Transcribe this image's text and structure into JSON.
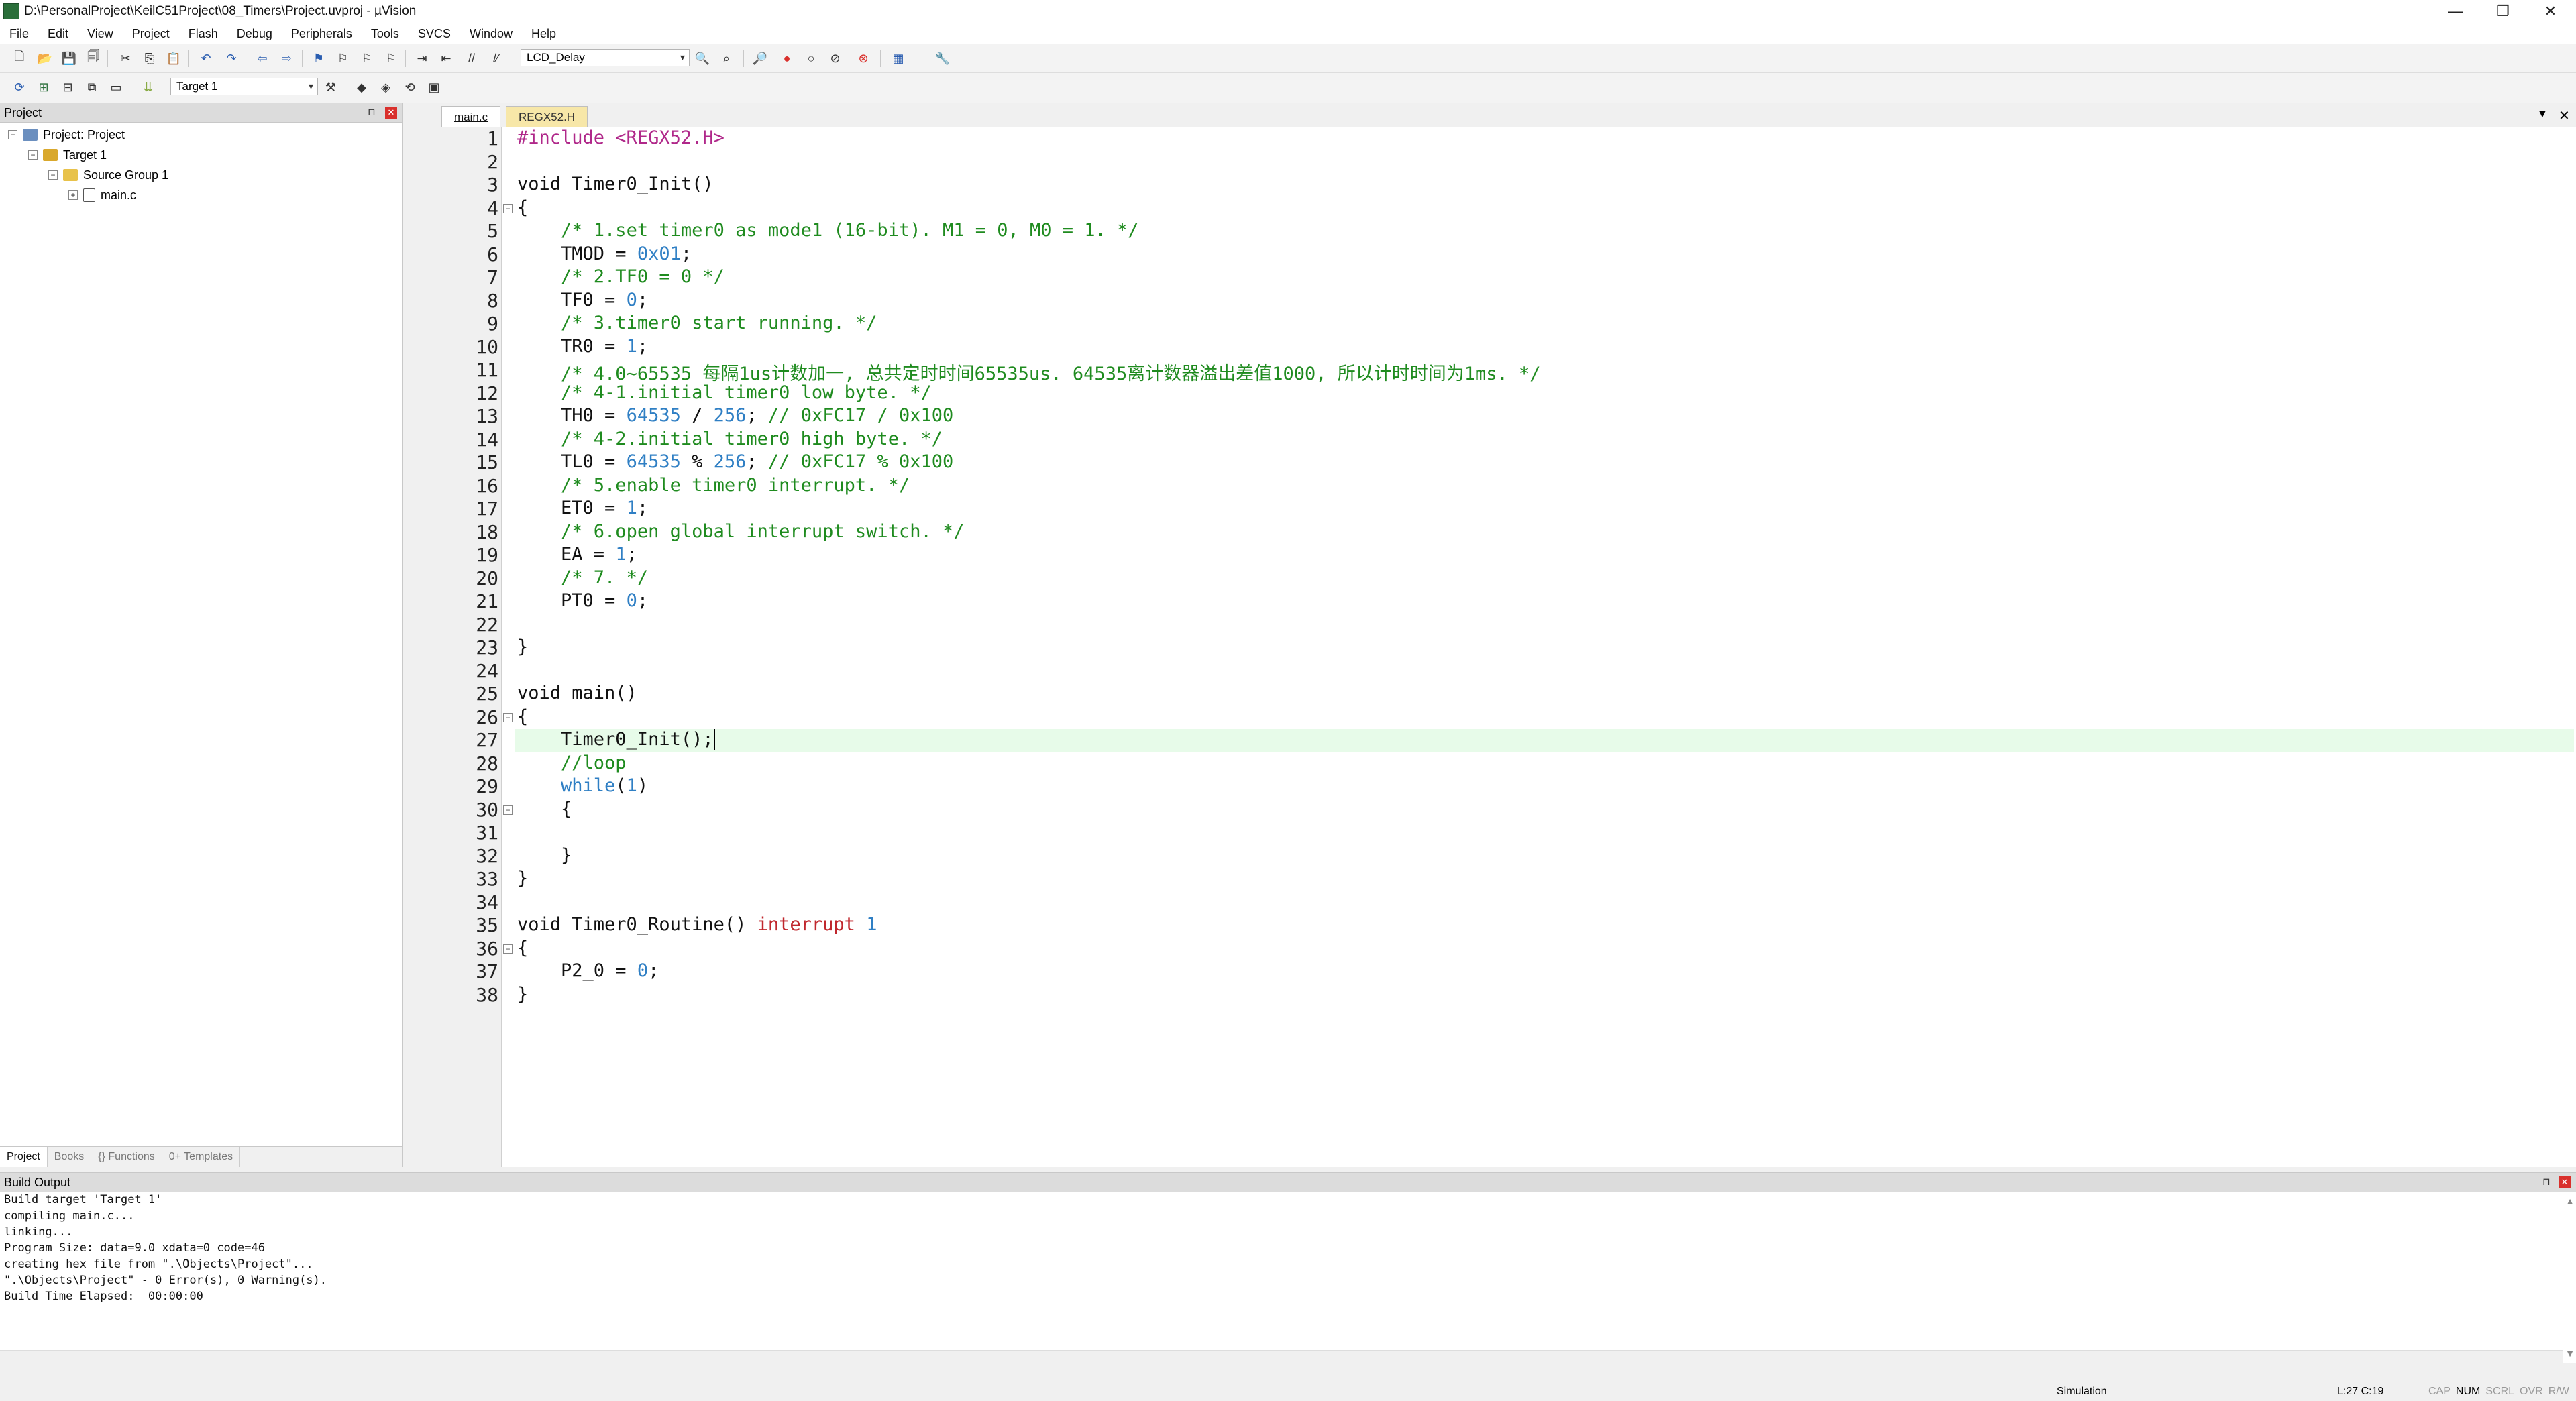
{
  "window": {
    "title": "D:\\PersonalProject\\KeilC51Project\\08_Timers\\Project.uvproj - µVision",
    "controls": {
      "minimize": "—",
      "maximize": "❐",
      "close": "✕"
    }
  },
  "menu": [
    "File",
    "Edit",
    "View",
    "Project",
    "Flash",
    "Debug",
    "Peripherals",
    "Tools",
    "SVCS",
    "Window",
    "Help"
  ],
  "toolbar1": {
    "combo_value": "LCD_Delay",
    "icons": [
      "new-file-icon",
      "open-icon",
      "save-icon",
      "save-all-icon",
      "cut-icon",
      "copy-icon",
      "paste-icon",
      "undo-icon",
      "redo-icon",
      "nav-back-icon",
      "nav-forward-icon",
      "bookmark-icon",
      "bookmark-prev-icon",
      "bookmark-next-icon",
      "bookmark-clear-icon",
      "indent-icon",
      "outdent-icon",
      "comment-icon",
      "uncomment-icon",
      "find-in-files-icon",
      "incremental-find-icon",
      "debug-start-icon",
      "breakpoint-insert-icon",
      "breakpoint-enable-icon",
      "breakpoint-disable-icon",
      "breakpoint-kill-icon",
      "window-layout-icon",
      "configure-icon"
    ]
  },
  "toolbar2": {
    "target_value": "Target 1",
    "icons": [
      "translate-icon",
      "build-icon",
      "rebuild-icon",
      "batch-build-icon",
      "stop-build-icon",
      "download-icon",
      "target-options-icon",
      "manage-components-icon",
      "select-pack-icon",
      "run-time-env-icon",
      "event-recorder-icon"
    ]
  },
  "project_pane": {
    "header": "Project",
    "tree": [
      {
        "label": "Project: Project",
        "level": 0,
        "expander": "−",
        "icon": "project-icon"
      },
      {
        "label": "Target 1",
        "level": 1,
        "expander": "−",
        "icon": "target-folder-icon"
      },
      {
        "label": "Source Group 1",
        "level": 2,
        "expander": "−",
        "icon": "folder-icon"
      },
      {
        "label": "main.c",
        "level": 3,
        "expander": "+",
        "icon": "c-file-icon"
      }
    ],
    "tabs": [
      "Project",
      "Books",
      "{} Functions",
      "0+ Templates"
    ]
  },
  "editor": {
    "tabs": [
      {
        "label": "main.c",
        "active": true
      },
      {
        "label": "REGX52.H",
        "active": false
      }
    ],
    "cursor_line": 27,
    "lines": [
      [
        [
          "pp",
          "#include <REGX52.H>"
        ]
      ],
      [],
      [
        [
          "kw",
          "void Timer0_Init()"
        ]
      ],
      [
        [
          "kw",
          "{"
        ]
      ],
      [
        [
          "kw",
          "    "
        ],
        [
          "cm",
          "/* 1.set timer0 as mode1 (16-bit). M1 = 0, M0 = 1. */"
        ]
      ],
      [
        [
          "kw",
          "    TMOD = "
        ],
        [
          "num",
          "0x01"
        ],
        [
          "kw",
          ";"
        ]
      ],
      [
        [
          "kw",
          "    "
        ],
        [
          "cm",
          "/* 2.TF0 = 0 */"
        ]
      ],
      [
        [
          "kw",
          "    TF0 = "
        ],
        [
          "num",
          "0"
        ],
        [
          "kw",
          ";"
        ]
      ],
      [
        [
          "kw",
          "    "
        ],
        [
          "cm",
          "/* 3.timer0 start running. */"
        ]
      ],
      [
        [
          "kw",
          "    TR0 = "
        ],
        [
          "num",
          "1"
        ],
        [
          "kw",
          ";"
        ]
      ],
      [
        [
          "kw",
          "    "
        ],
        [
          "cm",
          "/* 4.0~65535 每隔1us计数加一, 总共定时时间65535us. 64535离计数器溢出差值1000, 所以计时时间为1ms. */"
        ]
      ],
      [
        [
          "kw",
          "    "
        ],
        [
          "cm",
          "/* 4-1.initial timer0 low byte. */"
        ]
      ],
      [
        [
          "kw",
          "    TH0 = "
        ],
        [
          "num",
          "64535"
        ],
        [
          "kw",
          " / "
        ],
        [
          "num",
          "256"
        ],
        [
          "kw",
          "; "
        ],
        [
          "cm",
          "// 0xFC17 / 0x100"
        ]
      ],
      [
        [
          "kw",
          "    "
        ],
        [
          "cm",
          "/* 4-2.initial timer0 high byte. */"
        ]
      ],
      [
        [
          "kw",
          "    TL0 = "
        ],
        [
          "num",
          "64535"
        ],
        [
          "kw",
          " % "
        ],
        [
          "num",
          "256"
        ],
        [
          "kw",
          "; "
        ],
        [
          "cm",
          "// 0xFC17 % 0x100"
        ]
      ],
      [
        [
          "kw",
          "    "
        ],
        [
          "cm",
          "/* 5.enable timer0 interrupt. */"
        ]
      ],
      [
        [
          "kw",
          "    ET0 = "
        ],
        [
          "num",
          "1"
        ],
        [
          "kw",
          ";"
        ]
      ],
      [
        [
          "kw",
          "    "
        ],
        [
          "cm",
          "/* 6.open global interrupt switch. */"
        ]
      ],
      [
        [
          "kw",
          "    EA = "
        ],
        [
          "num",
          "1"
        ],
        [
          "kw",
          ";"
        ]
      ],
      [
        [
          "kw",
          "    "
        ],
        [
          "cm",
          "/* 7. */"
        ]
      ],
      [
        [
          "kw",
          "    PT0 = "
        ],
        [
          "num",
          "0"
        ],
        [
          "kw",
          ";"
        ]
      ],
      [],
      [
        [
          "kw",
          "}"
        ]
      ],
      [],
      [
        [
          "kw",
          "void main()"
        ]
      ],
      [
        [
          "kw",
          "{"
        ]
      ],
      [
        [
          "kw",
          "    Timer0_Init();"
        ]
      ],
      [
        [
          "kw",
          "    "
        ],
        [
          "cm",
          "//loop"
        ]
      ],
      [
        [
          "kw",
          "    "
        ],
        [
          "num",
          "while"
        ],
        [
          "kw",
          "("
        ],
        [
          "num",
          "1"
        ],
        [
          "kw",
          ")"
        ]
      ],
      [
        [
          "kw",
          "    {"
        ]
      ],
      [],
      [
        [
          "kw",
          "    }"
        ]
      ],
      [
        [
          "kw",
          "}"
        ]
      ],
      [],
      [
        [
          "kw",
          "void Timer0_Routine() "
        ],
        [
          "red",
          "interrupt"
        ],
        [
          "kw",
          " "
        ],
        [
          "num",
          "1"
        ]
      ],
      [
        [
          "kw",
          "{"
        ]
      ],
      [
        [
          "kw",
          "    P2_0 = "
        ],
        [
          "num",
          "0"
        ],
        [
          "kw",
          ";"
        ]
      ],
      [
        [
          "kw",
          "}"
        ]
      ]
    ],
    "fold_lines": [
      4,
      26,
      30,
      36
    ]
  },
  "build_output": {
    "header": "Build Output",
    "lines": [
      "Build target 'Target 1'",
      "compiling main.c...",
      "linking...",
      "Program Size: data=9.0 xdata=0 code=46",
      "creating hex file from \".\\Objects\\Project\"...",
      "\".\\Objects\\Project\" - 0 Error(s), 0 Warning(s).",
      "Build Time Elapsed:  00:00:00"
    ]
  },
  "status_bar": {
    "mode": "Simulation",
    "position": "L:27 C:19",
    "indicators": [
      "CAP",
      "NUM",
      "SCRL",
      "OVR",
      "R/W"
    ],
    "active_indicators": [
      "NUM"
    ]
  }
}
